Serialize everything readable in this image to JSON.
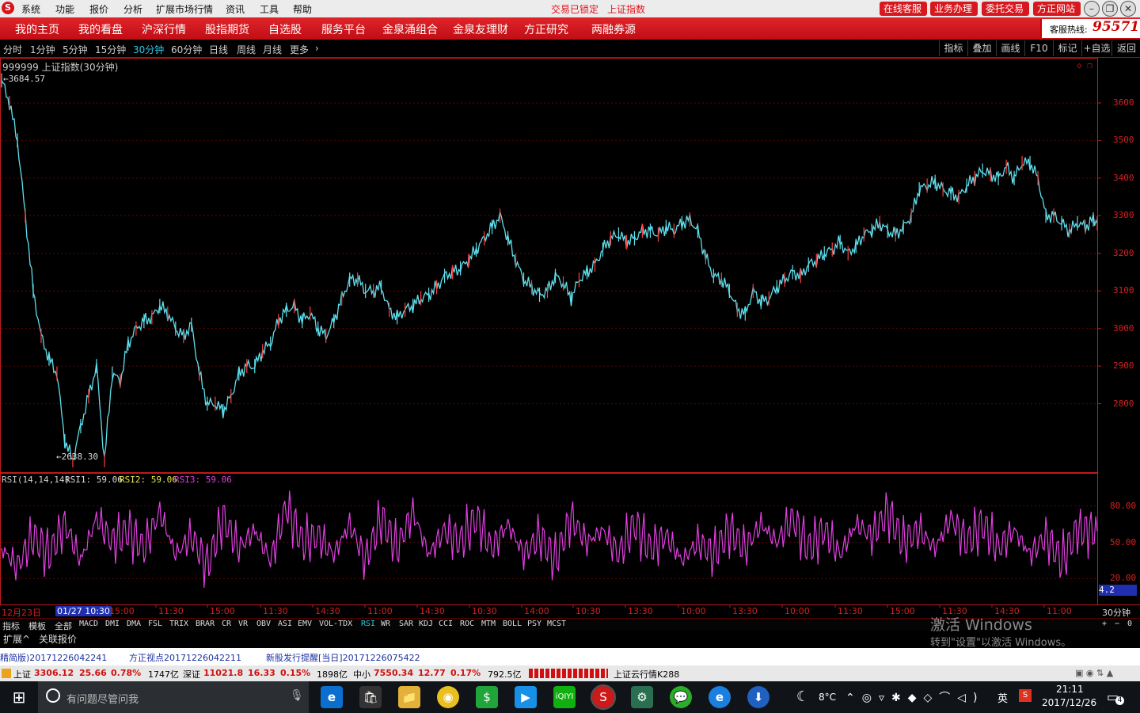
{
  "titlebar": {
    "menus": [
      "系统",
      "功能",
      "报价",
      "分析",
      "扩展市场行情",
      "资讯",
      "工具",
      "帮助"
    ],
    "lock_status": "交易已锁定",
    "current_name": "上证指数",
    "buttons": [
      "在线客服",
      "业务办理",
      "委托交易",
      "方正网站"
    ]
  },
  "navbar": {
    "items": [
      "我的主页",
      "我的看盘",
      "沪深行情",
      "股指期货",
      "自选股",
      "服务平台",
      "金泉涌组合",
      "金泉友理财",
      "方正研究",
      "两融券源"
    ],
    "hotline_label": "客服热线:",
    "hotline_number": "95571"
  },
  "periodbar": {
    "periods": [
      "分时",
      "1分钟",
      "5分钟",
      "15分钟",
      "30分钟",
      "60分钟",
      "日线",
      "周线",
      "月线",
      "更多"
    ],
    "active": "30分钟",
    "tools": [
      "指标",
      "叠加",
      "画线",
      "F10",
      "标记",
      "+自选",
      "返回"
    ]
  },
  "chart_info": {
    "title": "999999 上证指数(30分钟)",
    "high_label": "3684.57",
    "low_label": "2638.30"
  },
  "rsi": {
    "label": "RSI(14,14,14)",
    "rsi1_label": "RSI1: 59.06",
    "rsi2_label": "RSI2: 59.06",
    "rsi3_label": "RSI3: 59.06",
    "current": "4.2"
  },
  "chart_data": [
    {
      "type": "line",
      "title": "999999 上证指数(30分钟)",
      "ylim": [
        2620,
        3720
      ],
      "yticks": [
        3600,
        3500,
        3400,
        3300,
        3200,
        3100,
        3000,
        2900,
        2800
      ],
      "high": 3684.57,
      "low": 2638.3,
      "series": [
        {
          "name": "",
          "x": [
            0,
            10,
            20,
            30,
            40,
            50,
            60,
            70,
            80,
            90,
            100,
            110,
            120,
            130,
            140,
            150,
            160,
            170,
            180,
            190,
            200,
            210,
            220,
            230,
            240,
            250,
            260,
            270,
            280,
            290,
            300,
            310,
            320,
            330,
            340,
            350,
            360,
            370,
            380,
            390,
            400,
            410,
            420,
            430,
            440,
            450,
            460,
            470,
            480,
            490,
            500,
            510,
            520,
            530,
            540,
            550,
            560,
            570,
            580,
            590,
            600,
            610,
            620,
            630,
            640,
            650,
            660,
            670,
            680,
            690,
            700,
            710,
            720,
            730,
            740,
            750,
            760,
            770,
            780,
            790,
            800,
            810,
            820,
            830,
            840,
            850,
            860,
            870,
            880,
            890,
            900,
            910,
            920,
            930,
            940,
            950,
            960,
            970,
            980,
            990,
            1000,
            1010,
            1020,
            1030,
            1040,
            1050,
            1060,
            1070,
            1080,
            1090,
            1100,
            1110,
            1120,
            1130,
            1140,
            1150,
            1160,
            1170,
            1180,
            1190,
            1200,
            1210,
            1220,
            1230,
            1240,
            1250,
            1260,
            1270,
            1280,
            1290,
            1300,
            1310,
            1320,
            1330,
            1340,
            1350,
            1360,
            1370,
            1380,
            1385
          ],
          "values": [
            3660,
            3600,
            3500,
            3300,
            3100,
            2980,
            2920,
            2880,
            2700,
            2650,
            2740,
            2820,
            2900,
            2650,
            2880,
            2860,
            2960,
            3000,
            3020,
            3030,
            3060,
            3040,
            3000,
            2980,
            3010,
            2880,
            2800,
            2800,
            2780,
            2820,
            2880,
            2900,
            2900,
            2940,
            2960,
            3020,
            3050,
            3060,
            3020,
            3040,
            3000,
            2980,
            3020,
            3080,
            3130,
            3130,
            3100,
            3100,
            3110,
            3050,
            3030,
            3050,
            3060,
            3080,
            3090,
            3110,
            3140,
            3150,
            3160,
            3180,
            3210,
            3240,
            3270,
            3300,
            3240,
            3180,
            3130,
            3110,
            3090,
            3100,
            3140,
            3120,
            3080,
            3130,
            3150,
            3170,
            3210,
            3240,
            3250,
            3230,
            3240,
            3260,
            3260,
            3250,
            3270,
            3260,
            3280,
            3290,
            3260,
            3190,
            3140,
            3130,
            3100,
            3050,
            3040,
            3100,
            3070,
            3080,
            3110,
            3130,
            3150,
            3140,
            3170,
            3180,
            3200,
            3210,
            3230,
            3200,
            3220,
            3250,
            3260,
            3280,
            3260,
            3250,
            3270,
            3300,
            3370,
            3380,
            3390,
            3370,
            3360,
            3350,
            3380,
            3400,
            3420,
            3410,
            3400,
            3430,
            3400,
            3440,
            3440,
            3400,
            3300,
            3300,
            3280,
            3260,
            3280,
            3270,
            3290,
            3280
          ]
        }
      ]
    },
    {
      "type": "line",
      "title": "RSI(14,14,14)",
      "ylim": [
        0,
        100
      ],
      "yticks": [
        80,
        50,
        20
      ],
      "series": [
        {
          "name": "RSI1",
          "x": [
            0,
            20,
            40,
            60,
            80,
            100,
            120,
            140,
            160,
            180,
            200,
            220,
            240,
            260,
            280,
            300,
            320,
            340,
            360,
            380,
            400,
            420,
            440,
            460,
            480,
            500,
            520,
            540,
            560,
            580,
            600,
            620,
            640,
            660,
            680,
            700,
            720,
            740,
            760,
            780,
            800,
            820,
            840,
            860,
            880,
            900,
            920,
            940,
            960,
            980,
            1000,
            1020,
            1040,
            1060,
            1080,
            1100,
            1120,
            1140,
            1160,
            1180,
            1200,
            1220,
            1240,
            1260,
            1280,
            1300,
            1320,
            1340,
            1360,
            1385
          ],
          "values": [
            45,
            30,
            55,
            40,
            65,
            35,
            70,
            50,
            60,
            45,
            75,
            40,
            55,
            30,
            70,
            45,
            60,
            35,
            80,
            50,
            55,
            40,
            65,
            35,
            70,
            45,
            75,
            40,
            60,
            50,
            70,
            45,
            65,
            40,
            55,
            35,
            70,
            50,
            60,
            40,
            65,
            45,
            55,
            35,
            50,
            40,
            60,
            45,
            65,
            50,
            70,
            45,
            60,
            40,
            65,
            55,
            75,
            50,
            60,
            45,
            70,
            50,
            65,
            45,
            60,
            40,
            55,
            35,
            60,
            59.06
          ]
        }
      ]
    }
  ],
  "xaxis": {
    "start_label": "12月23日",
    "cursor_label": "01/27 10:30",
    "ticks": [
      "15:00",
      "11:30",
      "15:00",
      "11:30",
      "14:30",
      "11:00",
      "14:30",
      "10:30",
      "14:00",
      "10:30",
      "13:30",
      "10:00",
      "13:30",
      "10:00",
      "11:30",
      "15:00",
      "11:30",
      "14:30",
      "11:00"
    ],
    "period_label": "30分钟"
  },
  "indicator_tabs": [
    "指标",
    "模板",
    "全部",
    "MACD",
    "DMI",
    "DMA",
    "FSL",
    "TRIX",
    "BRAR",
    "CR",
    "VR",
    "OBV",
    "ASI",
    "EMV",
    "VOL-TDX",
    "RSI",
    "WR",
    "SAR",
    "KDJ",
    "CCI",
    "ROC",
    "MTM",
    "BOLL",
    "PSY",
    "MCST"
  ],
  "indicator_active": "RSI",
  "zoom_controls": [
    "+",
    "−",
    "0"
  ],
  "ext_tabs": [
    "扩展^",
    "关联报价"
  ],
  "watermark": {
    "line1": "激活 Windows",
    "line2": "转到\"设置\"以激活 Windows。"
  },
  "news": [
    "精简版)20171226042241",
    "方正视点20171226042211",
    "新股发行提醒[当日]20171226075422"
  ],
  "status": {
    "sh_label": "上证",
    "sh_value": "3306.12",
    "sh_change": "25.66",
    "sh_pct": "0.78%",
    "sh_amount": "1747亿",
    "sz_label": "深证",
    "sz_value": "11021.8",
    "sz_change": "16.33",
    "sz_pct": "0.15%",
    "sz_amount": "1898亿",
    "zx_label": "中小",
    "zx_value": "7550.34",
    "zx_change": "12.77",
    "zx_pct": "0.17%",
    "zx_amount": "792.5亿",
    "cloud": "上证云行情K288"
  },
  "taskbar": {
    "search_placeholder": "有问题尽管问我",
    "weather": "8°C",
    "ime": "英",
    "time": "21:11",
    "date": "2017/12/26",
    "notif_count": "4"
  },
  "colors": {
    "price_line": "#5ee0ee",
    "rsi_line": "#e040e0",
    "axis_red": "#c01a1a",
    "grid_red": "#5a0808"
  }
}
